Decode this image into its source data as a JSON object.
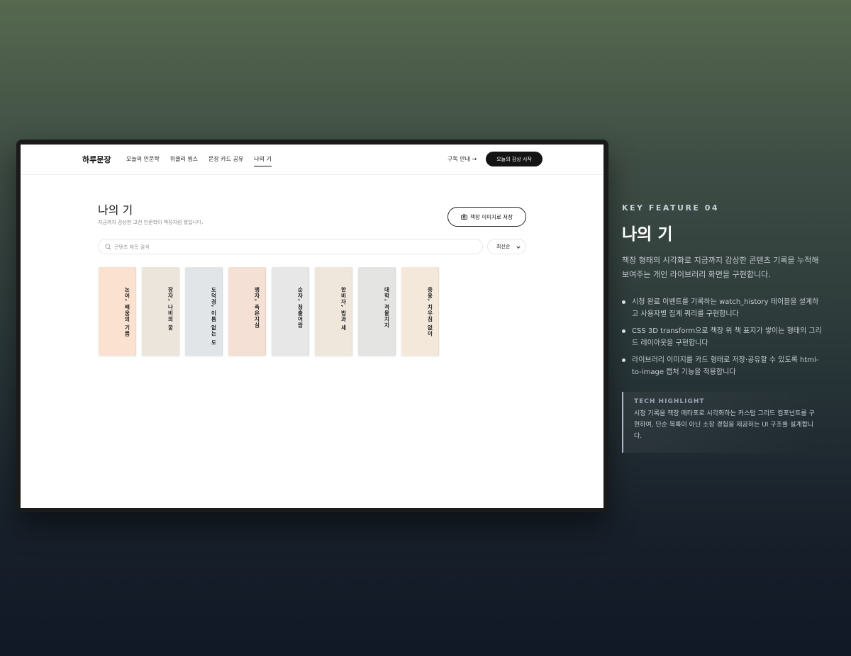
{
  "nav": {
    "logo": "하루문장",
    "links": [
      "오늘의 인문학",
      "위클리 씽스",
      "문장 카드 공유",
      "나의 기"
    ],
    "subscribe": "구독 안내 →",
    "start": "오늘의 감상 시작"
  },
  "page": {
    "title": "나의 기",
    "subtitle": "지금까지 감상한 고전 인문학이 책장처럼 쌓입니다.",
    "save_button": "책장 이미지로 저장",
    "search_placeholder": "콘텐츠 제목 검색",
    "sort": "최신순"
  },
  "books": [
    {
      "title": "논어, 배움의 기쁨",
      "color": "#fbe1d0"
    },
    {
      "title": "장자, 나비의 꿈",
      "color": "#ece5dc"
    },
    {
      "title": "도덕경, 이름 없는 도",
      "color": "#e1e5e8"
    },
    {
      "title": "맹자, 측은지심",
      "color": "#f4e0d4"
    },
    {
      "title": "순자, 청출어람",
      "color": "#e7e7e8"
    },
    {
      "title": "한비자, 법과 세",
      "color": "#efe6dc"
    },
    {
      "title": "대학, 격물치지",
      "color": "#e4e5e3"
    },
    {
      "title": "중용, 치우침 없이",
      "color": "#f3e8da"
    }
  ],
  "panel": {
    "label": "KEY FEATURE 04",
    "title": "나의 기",
    "desc": "책장 형태의 시각화로 지금까지 감상한 콘텐츠 기록을 누적해 보여주는 개인 라이브러리 화면을 구현합니다.",
    "bullets": [
      "시청 완료 이벤트를 기록하는 watch_history 테이블을 설계하고 사용자별 집계 쿼리를 구현합니다",
      "CSS 3D transform으로 책장 위 책 표지가 쌓이는 형태의 그리드 레이아웃을 구현합니다",
      "라이브러리 이미지를 카드 형태로 저장·공유할 수 있도록 html-to-image 캡처 기능을 적용합니다"
    ],
    "tech_label": "TECH HIGHLIGHT",
    "tech_text": "시청 기록을 책장 메타포로 시각화하는 커스텀 그리드 컴포넌트를 구현하여, 단순 목록이 아닌 소장 경험을 제공하는 UI 구조를 설계합니다."
  }
}
